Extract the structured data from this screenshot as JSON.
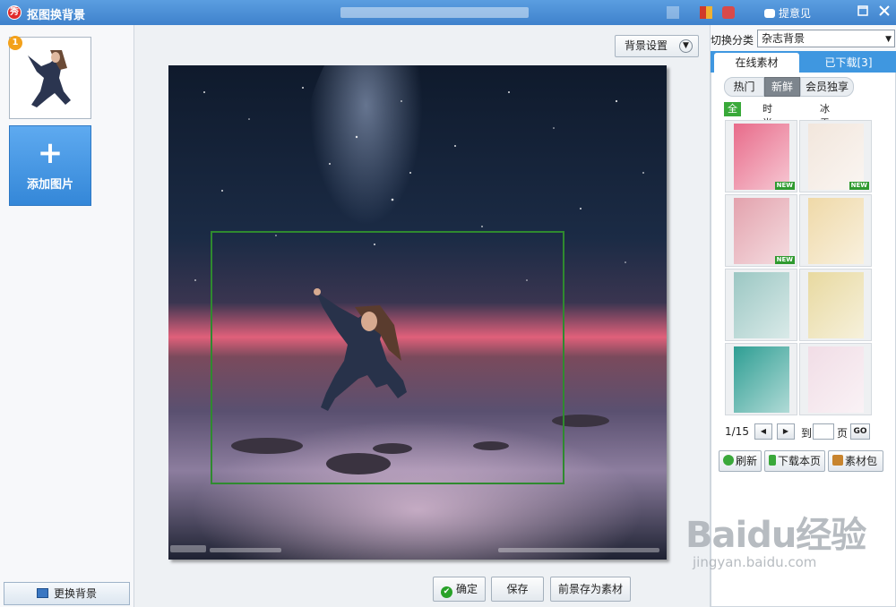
{
  "window": {
    "title": "抠图换背景",
    "feedback_label": "提意见",
    "logo_char": "秀"
  },
  "left": {
    "thumbnail_badge": "1",
    "add_image_label": "添加图片",
    "replace_bg_label": "更换背景"
  },
  "center": {
    "bg_settings_label": "背景设置",
    "confirm_label": "确定",
    "save_label": "保存",
    "save_fg_label": "前景存为素材"
  },
  "right": {
    "category_label": "切换分类",
    "category_value": "杂志背景",
    "tabs": [
      {
        "label": "在线素材",
        "active": true
      },
      {
        "label": "已下载[3]",
        "active": false
      }
    ],
    "sub_tabs": [
      {
        "label": "热门",
        "active": false
      },
      {
        "label": "新鲜",
        "active": true
      },
      {
        "label": "会员独享",
        "active": false
      }
    ],
    "filters": [
      {
        "label": "全部",
        "active": true
      },
      {
        "label": "时尚girl",
        "active": false
      },
      {
        "label": "冰雪girl",
        "active": false
      }
    ],
    "materials": [
      {
        "badge": "NEW",
        "color": "#e86b8a"
      },
      {
        "badge": "NEW",
        "color": "#f2e6dc"
      },
      {
        "badge": "NEW",
        "color": "#e3a2ad"
      },
      {
        "badge": "",
        "color": "#efd9a8"
      },
      {
        "badge": "",
        "color": "#9bc7c3"
      },
      {
        "badge": "",
        "color": "#e8d9a0"
      },
      {
        "badge": "",
        "color": "#2e9e93"
      },
      {
        "badge": "",
        "color": "#f1dde6"
      }
    ],
    "pager": {
      "current": "1/15",
      "goto_prefix": "到",
      "goto_suffix": "页",
      "go_label": "GO"
    },
    "actions": {
      "refresh_label": "刷新",
      "download_page_label": "下载本页",
      "material_pack_label": "素材包"
    }
  },
  "watermark": {
    "main": "Baidu经验",
    "sub": "jingyan.baidu.com"
  },
  "colors": {
    "titlebar": "#4a8fd6",
    "accent_tab": "#3f97e0",
    "crop_frame": "#2f8a2f",
    "new_badge": "#2f9a2f"
  }
}
